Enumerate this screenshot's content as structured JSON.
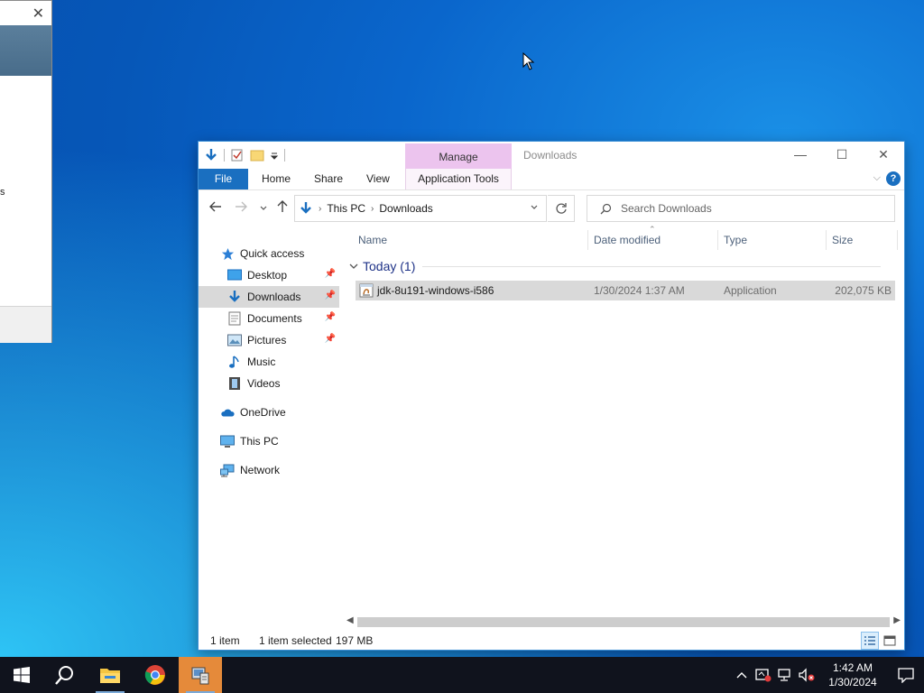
{
  "background_dialog": {
    "close_glyph": "✕",
    "fragment_text": "s"
  },
  "explorer": {
    "title": "Downloads",
    "contextual_tab": "Manage",
    "ribbon": {
      "file": "File",
      "home": "Home",
      "share": "Share",
      "view": "View",
      "app_tools": "Application Tools"
    },
    "window_controls": {
      "minimize": "—",
      "maximize": "☐",
      "close": "✕"
    },
    "address": {
      "crumbs": [
        "This PC",
        "Downloads"
      ],
      "search_placeholder": "Search Downloads"
    },
    "nav": {
      "quick_access": "Quick access",
      "desktop": "Desktop",
      "downloads": "Downloads",
      "documents": "Documents",
      "pictures": "Pictures",
      "music": "Music",
      "videos": "Videos",
      "onedrive": "OneDrive",
      "this_pc": "This PC",
      "network": "Network"
    },
    "columns": {
      "name": "Name",
      "date": "Date modified",
      "type": "Type",
      "size": "Size"
    },
    "group": {
      "label": "Today (1)"
    },
    "files": [
      {
        "name": "jdk-8u191-windows-i586",
        "date": "1/30/2024 1:37 AM",
        "type": "Application",
        "size": "202,075 KB"
      }
    ],
    "status": {
      "count": "1 item",
      "selected": "1 item selected",
      "size": "197 MB"
    }
  },
  "taskbar": {
    "clock_time": "1:42 AM",
    "clock_date": "1/30/2024",
    "icons": [
      "windows-start-icon",
      "search-icon",
      "file-explorer-icon",
      "chrome-icon",
      "installer-icon"
    ]
  },
  "colors": {
    "accent": "#1a6fc0",
    "manage_tab": "#ecc4ee",
    "taskbar": "#10131d",
    "selection": "#d9d9d9"
  }
}
